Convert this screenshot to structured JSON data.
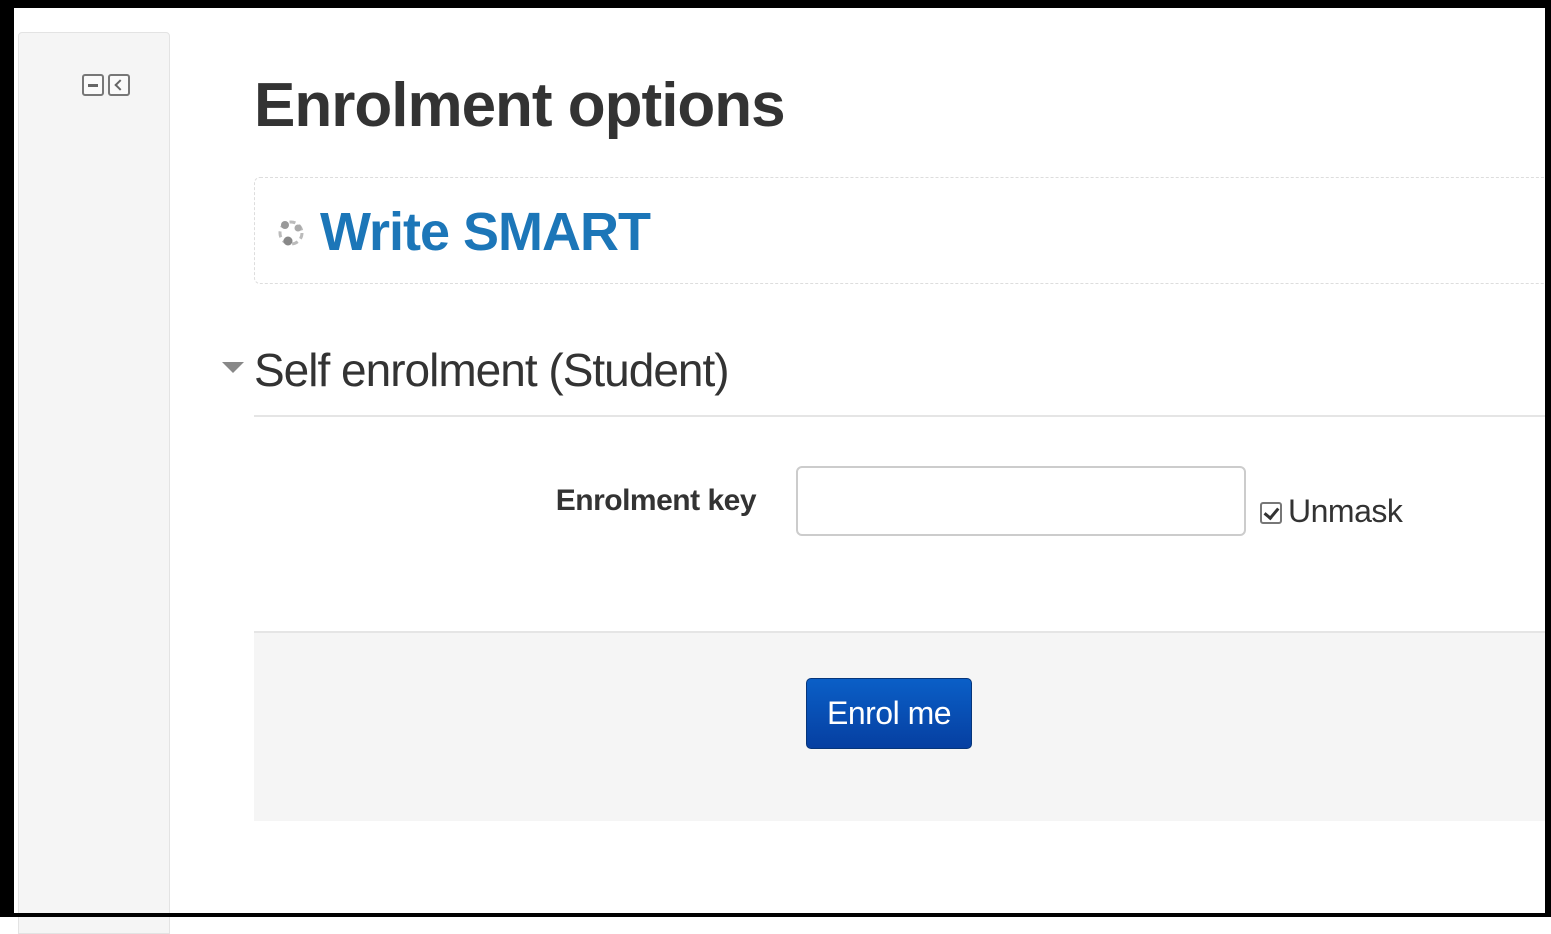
{
  "page": {
    "title": "Enrolment options"
  },
  "block_controls": {
    "items": [
      {
        "icon": "minus-square-icon"
      },
      {
        "icon": "chevron-left-square-icon"
      }
    ]
  },
  "course": {
    "icon": "course-icon",
    "name": "Write SMART",
    "link_color": "#1c76b8"
  },
  "self_enrolment": {
    "legend": "Self enrolment (Student)",
    "toggle_icon": "caret-down-icon",
    "key_label": "Enrolment key",
    "key_value": "",
    "unmask_label": "Unmask",
    "unmask_checked": true,
    "submit_label": "Enrol me",
    "button_color": "#0a5fc7"
  }
}
